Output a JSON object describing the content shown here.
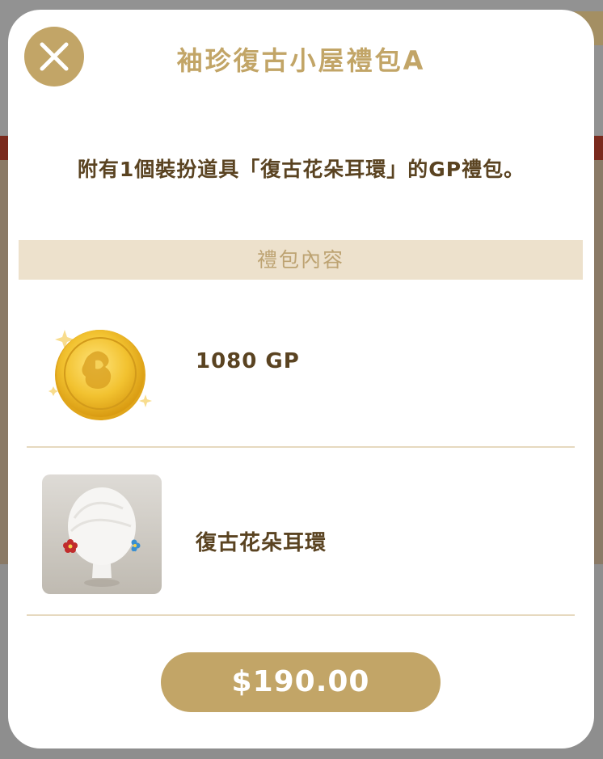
{
  "dialog": {
    "title": "袖珍復古小屋禮包A",
    "description": "附有1個裝扮道具「復古花朵耳環」的GP禮包。",
    "close_icon": "close-icon"
  },
  "bundle": {
    "section_title": "禮包內容",
    "items": [
      {
        "label": "1080 GP",
        "icon": "gold-coin-icon"
      },
      {
        "label": "復古花朵耳環",
        "icon": "flower-earrings-icon"
      }
    ]
  },
  "purchase": {
    "price_label": "$190.00"
  },
  "colors": {
    "accent": "#c2a567",
    "header_bg": "#ede1cc",
    "text": "#5a4321",
    "divider": "#e6d9bf"
  }
}
